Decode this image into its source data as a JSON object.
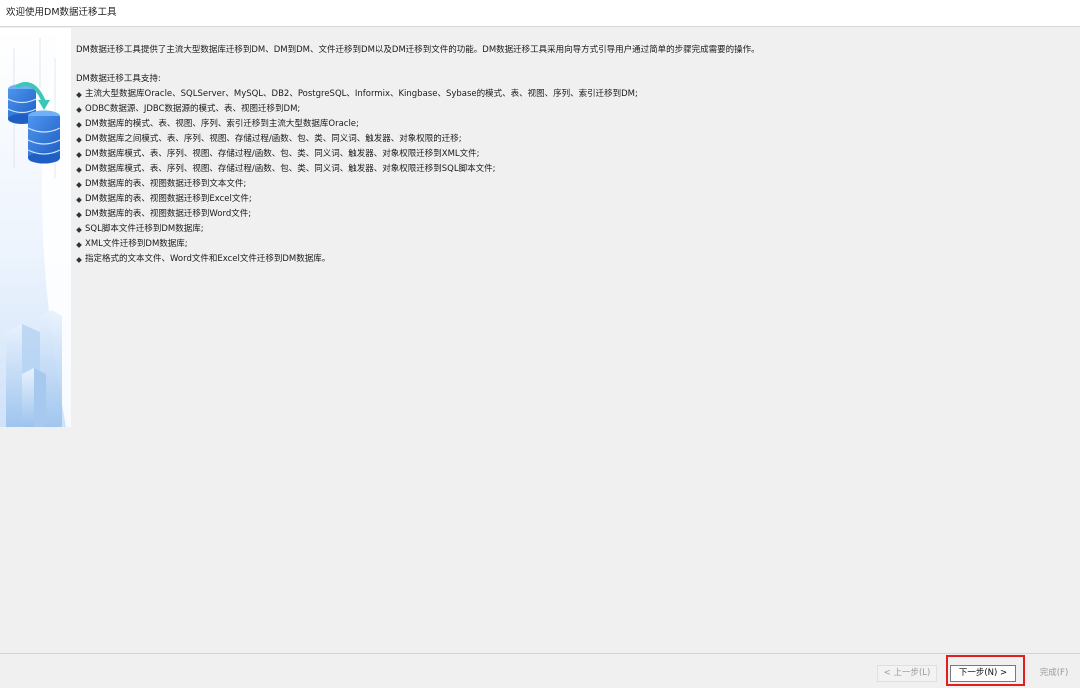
{
  "window": {
    "title": "欢迎使用DM数据迁移工具"
  },
  "main": {
    "intro": "DM数据迁移工具提供了主流大型数据库迁移到DM、DM到DM、文件迁移到DM以及DM迁移到文件的功能。DM数据迁移工具采用向导方式引导用户通过简单的步骤完成需要的操作。",
    "support_title": "DM数据迁移工具支持:",
    "features": [
      "主流大型数据库Oracle、SQLServer、MySQL、DB2、PostgreSQL、Informix、Kingbase、Sybase的模式、表、视图、序列、索引迁移到DM;",
      "ODBC数据源、JDBC数据源的模式、表、视图迁移到DM;",
      "DM数据库的模式、表、视图、序列、索引迁移到主流大型数据库Oracle;",
      "DM数据库之间模式、表、序列、视图、存储过程/函数、包、类、同义词、触发器、对象权限的迁移;",
      "DM数据库模式、表、序列、视图、存储过程/函数、包、类、同义词、触发器、对象权限迁移到XML文件;",
      "DM数据库模式、表、序列、视图、存储过程/函数、包、类、同义词、触发器、对象权限迁移到SQL脚本文件;",
      "DM数据库的表、视图数据迁移到文本文件;",
      "DM数据库的表、视图数据迁移到Excel文件;",
      "DM数据库的表、视图数据迁移到Word文件;",
      "SQL脚本文件迁移到DM数据库;",
      "XML文件迁移到DM数据库;",
      "指定格式的文本文件、Word文件和Excel文件迁移到DM数据库。"
    ]
  },
  "footer": {
    "prev_label": "< 上一步(L)",
    "next_label": "下一步(N) >",
    "finish_label": "完成(F)"
  },
  "colors": {
    "highlight": "#e02020",
    "accent_blue": "#2f74d8",
    "accent_teal": "#3cc6b8"
  },
  "icons": {
    "banner": "database-migration-illustration",
    "bullet": "diamond-bullet"
  }
}
